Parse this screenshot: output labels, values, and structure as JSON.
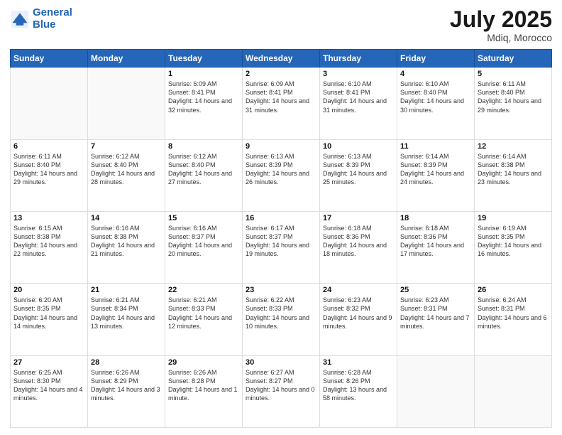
{
  "header": {
    "logo_line1": "General",
    "logo_line2": "Blue",
    "main_title": "July 2025",
    "subtitle": "Mdiq, Morocco"
  },
  "weekdays": [
    "Sunday",
    "Monday",
    "Tuesday",
    "Wednesday",
    "Thursday",
    "Friday",
    "Saturday"
  ],
  "weeks": [
    [
      {
        "day": "",
        "info": ""
      },
      {
        "day": "",
        "info": ""
      },
      {
        "day": "1",
        "info": "Sunrise: 6:09 AM\nSunset: 8:41 PM\nDaylight: 14 hours and 32 minutes."
      },
      {
        "day": "2",
        "info": "Sunrise: 6:09 AM\nSunset: 8:41 PM\nDaylight: 14 hours and 31 minutes."
      },
      {
        "day": "3",
        "info": "Sunrise: 6:10 AM\nSunset: 8:41 PM\nDaylight: 14 hours and 31 minutes."
      },
      {
        "day": "4",
        "info": "Sunrise: 6:10 AM\nSunset: 8:40 PM\nDaylight: 14 hours and 30 minutes."
      },
      {
        "day": "5",
        "info": "Sunrise: 6:11 AM\nSunset: 8:40 PM\nDaylight: 14 hours and 29 minutes."
      }
    ],
    [
      {
        "day": "6",
        "info": "Sunrise: 6:11 AM\nSunset: 8:40 PM\nDaylight: 14 hours and 29 minutes."
      },
      {
        "day": "7",
        "info": "Sunrise: 6:12 AM\nSunset: 8:40 PM\nDaylight: 14 hours and 28 minutes."
      },
      {
        "day": "8",
        "info": "Sunrise: 6:12 AM\nSunset: 8:40 PM\nDaylight: 14 hours and 27 minutes."
      },
      {
        "day": "9",
        "info": "Sunrise: 6:13 AM\nSunset: 8:39 PM\nDaylight: 14 hours and 26 minutes."
      },
      {
        "day": "10",
        "info": "Sunrise: 6:13 AM\nSunset: 8:39 PM\nDaylight: 14 hours and 25 minutes."
      },
      {
        "day": "11",
        "info": "Sunrise: 6:14 AM\nSunset: 8:39 PM\nDaylight: 14 hours and 24 minutes."
      },
      {
        "day": "12",
        "info": "Sunrise: 6:14 AM\nSunset: 8:38 PM\nDaylight: 14 hours and 23 minutes."
      }
    ],
    [
      {
        "day": "13",
        "info": "Sunrise: 6:15 AM\nSunset: 8:38 PM\nDaylight: 14 hours and 22 minutes."
      },
      {
        "day": "14",
        "info": "Sunrise: 6:16 AM\nSunset: 8:38 PM\nDaylight: 14 hours and 21 minutes."
      },
      {
        "day": "15",
        "info": "Sunrise: 6:16 AM\nSunset: 8:37 PM\nDaylight: 14 hours and 20 minutes."
      },
      {
        "day": "16",
        "info": "Sunrise: 6:17 AM\nSunset: 8:37 PM\nDaylight: 14 hours and 19 minutes."
      },
      {
        "day": "17",
        "info": "Sunrise: 6:18 AM\nSunset: 8:36 PM\nDaylight: 14 hours and 18 minutes."
      },
      {
        "day": "18",
        "info": "Sunrise: 6:18 AM\nSunset: 8:36 PM\nDaylight: 14 hours and 17 minutes."
      },
      {
        "day": "19",
        "info": "Sunrise: 6:19 AM\nSunset: 8:35 PM\nDaylight: 14 hours and 16 minutes."
      }
    ],
    [
      {
        "day": "20",
        "info": "Sunrise: 6:20 AM\nSunset: 8:35 PM\nDaylight: 14 hours and 14 minutes."
      },
      {
        "day": "21",
        "info": "Sunrise: 6:21 AM\nSunset: 8:34 PM\nDaylight: 14 hours and 13 minutes."
      },
      {
        "day": "22",
        "info": "Sunrise: 6:21 AM\nSunset: 8:33 PM\nDaylight: 14 hours and 12 minutes."
      },
      {
        "day": "23",
        "info": "Sunrise: 6:22 AM\nSunset: 8:33 PM\nDaylight: 14 hours and 10 minutes."
      },
      {
        "day": "24",
        "info": "Sunrise: 6:23 AM\nSunset: 8:32 PM\nDaylight: 14 hours and 9 minutes."
      },
      {
        "day": "25",
        "info": "Sunrise: 6:23 AM\nSunset: 8:31 PM\nDaylight: 14 hours and 7 minutes."
      },
      {
        "day": "26",
        "info": "Sunrise: 6:24 AM\nSunset: 8:31 PM\nDaylight: 14 hours and 6 minutes."
      }
    ],
    [
      {
        "day": "27",
        "info": "Sunrise: 6:25 AM\nSunset: 8:30 PM\nDaylight: 14 hours and 4 minutes."
      },
      {
        "day": "28",
        "info": "Sunrise: 6:26 AM\nSunset: 8:29 PM\nDaylight: 14 hours and 3 minutes."
      },
      {
        "day": "29",
        "info": "Sunrise: 6:26 AM\nSunset: 8:28 PM\nDaylight: 14 hours and 1 minute."
      },
      {
        "day": "30",
        "info": "Sunrise: 6:27 AM\nSunset: 8:27 PM\nDaylight: 14 hours and 0 minutes."
      },
      {
        "day": "31",
        "info": "Sunrise: 6:28 AM\nSunset: 8:26 PM\nDaylight: 13 hours and 58 minutes."
      },
      {
        "day": "",
        "info": ""
      },
      {
        "day": "",
        "info": ""
      }
    ]
  ]
}
